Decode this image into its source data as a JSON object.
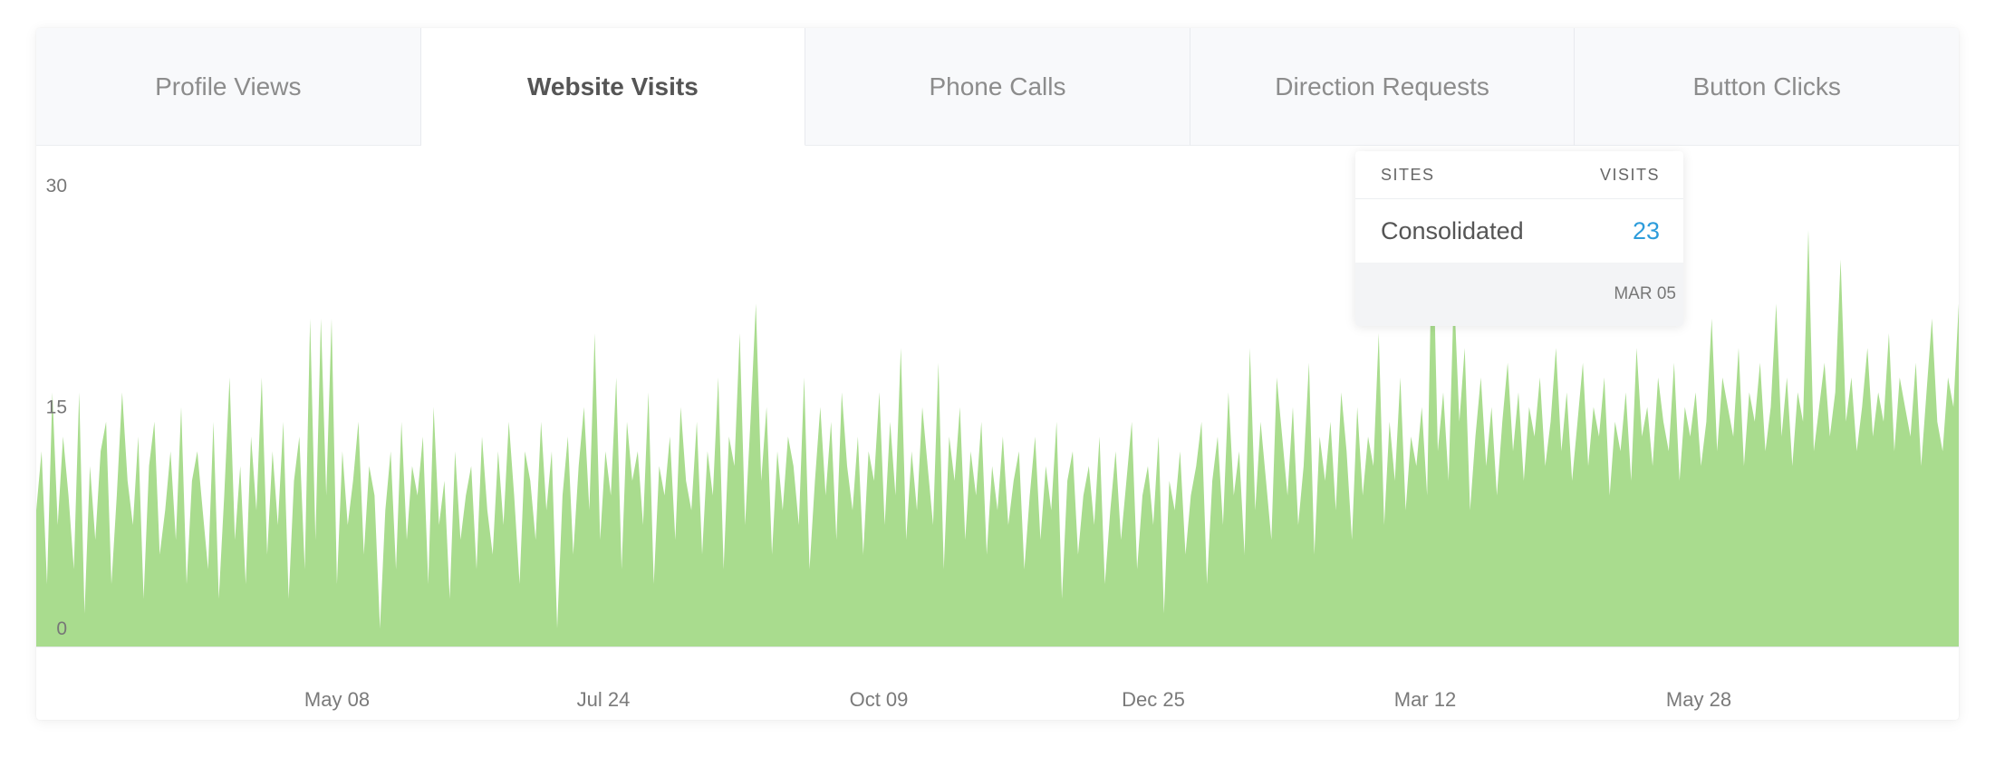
{
  "tabs": [
    {
      "label": "Profile Views",
      "active": false
    },
    {
      "label": "Website Visits",
      "active": true
    },
    {
      "label": "Phone Calls",
      "active": false
    },
    {
      "label": "Direction Requests",
      "active": false
    },
    {
      "label": "Button Clicks",
      "active": false
    }
  ],
  "tooltip": {
    "col_sites": "SITES",
    "col_visits": "VISITS",
    "site": "Consolidated",
    "visits": "23",
    "date": "MAR 05"
  },
  "colors": {
    "area_fill": "#a9dc8e",
    "marker": "#4db33d",
    "tooltip_value": "#2d9cdb"
  },
  "chart_data": {
    "type": "area",
    "title": "",
    "xlabel": "",
    "ylabel": "",
    "ylim": [
      0,
      30
    ],
    "yticks": [
      0,
      15,
      30
    ],
    "xtick_labels": [
      "May 08",
      "Jul 24",
      "Oct 09",
      "Dec 25",
      "Mar 12",
      "May 28"
    ],
    "grid": false,
    "series": [
      {
        "name": "Consolidated",
        "values": [
          8,
          12,
          3,
          16,
          7,
          13,
          9,
          4,
          16,
          1,
          11,
          6,
          12,
          14,
          3,
          9,
          16,
          10,
          7,
          13,
          2,
          11,
          14,
          5,
          8,
          12,
          6,
          15,
          3,
          10,
          12,
          8,
          4,
          14,
          2,
          9,
          17,
          6,
          11,
          3,
          13,
          8,
          17,
          5,
          12,
          7,
          14,
          2,
          10,
          13,
          4,
          21,
          6,
          21,
          9,
          21,
          3,
          12,
          7,
          10,
          14,
          5,
          11,
          9,
          0,
          8,
          12,
          4,
          14,
          6,
          11,
          9,
          13,
          3,
          15,
          7,
          10,
          2,
          12,
          6,
          9,
          11,
          4,
          13,
          8,
          5,
          12,
          7,
          14,
          9,
          3,
          12,
          10,
          6,
          14,
          8,
          12,
          0,
          9,
          13,
          5,
          11,
          15,
          8,
          20,
          6,
          12,
          9,
          17,
          4,
          14,
          10,
          12,
          7,
          16,
          3,
          11,
          9,
          13,
          6,
          15,
          10,
          8,
          14,
          5,
          12,
          9,
          17,
          4,
          13,
          11,
          20,
          7,
          14,
          22,
          10,
          15,
          5,
          12,
          8,
          13,
          11,
          7,
          17,
          4,
          10,
          15,
          9,
          14,
          6,
          16,
          11,
          8,
          13,
          5,
          12,
          10,
          16,
          7,
          14,
          9,
          19,
          6,
          12,
          8,
          15,
          11,
          7,
          18,
          4,
          13,
          10,
          15,
          6,
          12,
          9,
          14,
          5,
          11,
          8,
          13,
          7,
          10,
          12,
          4,
          9,
          13,
          6,
          11,
          8,
          14,
          2,
          10,
          12,
          5,
          9,
          11,
          7,
          13,
          3,
          8,
          12,
          6,
          10,
          14,
          4,
          9,
          11,
          7,
          13,
          1,
          10,
          8,
          12,
          5,
          9,
          11,
          14,
          3,
          10,
          13,
          7,
          16,
          9,
          12,
          5,
          19,
          8,
          14,
          10,
          6,
          17,
          13,
          9,
          15,
          7,
          11,
          18,
          5,
          13,
          10,
          14,
          8,
          16,
          12,
          6,
          15,
          9,
          13,
          11,
          20,
          7,
          14,
          10,
          17,
          8,
          13,
          11,
          15,
          9,
          28,
          12,
          16,
          10,
          23,
          14,
          19,
          8,
          13,
          17,
          11,
          15,
          9,
          14,
          18,
          12,
          16,
          10,
          15,
          13,
          17,
          11,
          14,
          19,
          12,
          16,
          10,
          14,
          18,
          11,
          15,
          13,
          17,
          9,
          14,
          12,
          16,
          10,
          19,
          13,
          15,
          11,
          17,
          14,
          12,
          18,
          10,
          15,
          13,
          16,
          11,
          14,
          21,
          12,
          17,
          15,
          13,
          19,
          11,
          16,
          14,
          18,
          12,
          15,
          22,
          13,
          17,
          11,
          16,
          14,
          27,
          12,
          15,
          18,
          13,
          16,
          25,
          14,
          17,
          12,
          15,
          19,
          13,
          16,
          14,
          20,
          12,
          17,
          15,
          13,
          18,
          11,
          16,
          21,
          14,
          12,
          17,
          15,
          22
        ]
      }
    ],
    "highlight": {
      "date": "MAR 05",
      "value": 23
    }
  }
}
